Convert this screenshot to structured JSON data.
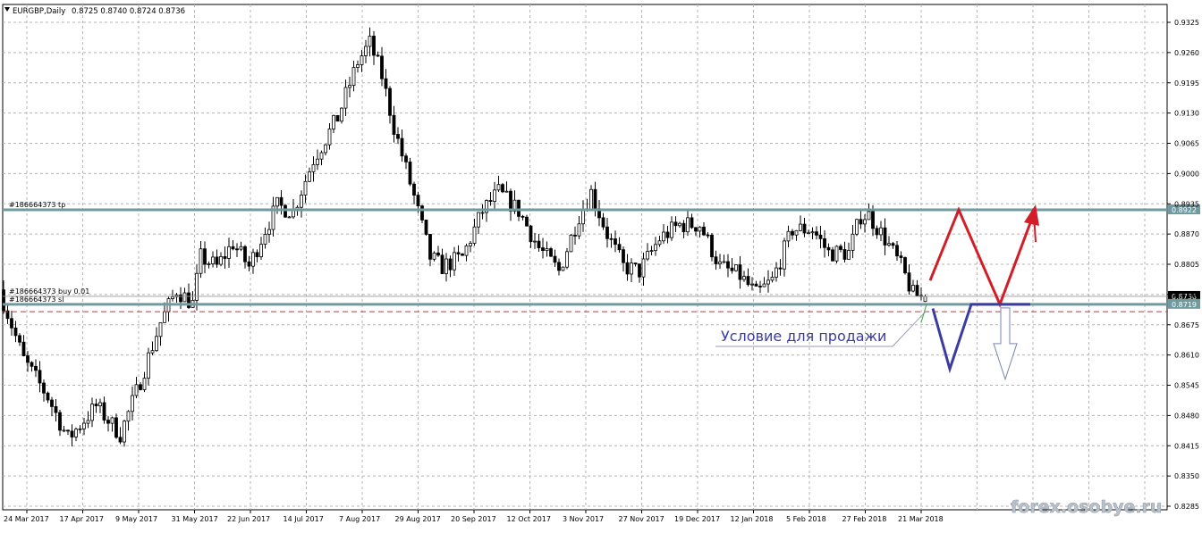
{
  "header": {
    "symbol": "EURGBP,Daily",
    "ohlc": "0.8725 0.8740 0.8724 0.8736"
  },
  "watermark": "forex.osobye.ru",
  "colors": {
    "background": "#ffffff",
    "grid": "#b4b4b4",
    "candle": "#000000",
    "level_line": "#6f9aa0",
    "dashed_line": "#c8323c",
    "price_tag": "#6f9aa0",
    "up_arrow": "#d21e28",
    "down_arrow": "#3c3ca0",
    "annotation_text": "#3c3ca0"
  },
  "chart_data": {
    "type": "candlestick",
    "title": "EURGBP,Daily",
    "y_ticks": [
      "0.9325",
      "0.9260",
      "0.9195",
      "0.9130",
      "0.9065",
      "0.9000",
      "0.8935",
      "0.8870",
      "0.8805",
      "0.8740",
      "0.8675",
      "0.8610",
      "0.8545",
      "0.8480",
      "0.8415",
      "0.8350",
      "0.8285"
    ],
    "x_ticks": [
      "24 Mar 2017",
      "17 Apr 2017",
      "9 May 2017",
      "31 May 2017",
      "22 Jun 2017",
      "14 Jul 2017",
      "7 Aug 2017",
      "29 Aug 2017",
      "20 Sep 2017",
      "12 Oct 2017",
      "3 Nov 2017",
      "27 Nov 2017",
      "19 Dec 2017",
      "12 Jan 2018",
      "5 Feb 2018",
      "27 Feb 2018",
      "21 Mar 2018"
    ],
    "ylim": [
      0.8285,
      0.9325
    ],
    "last": {
      "open": 0.8725,
      "high": 0.874,
      "low": 0.8724,
      "close": 0.8736
    },
    "price_path": [
      [
        0,
        0.875
      ],
      [
        6,
        0.86
      ],
      [
        12,
        0.852
      ],
      [
        17,
        0.843
      ],
      [
        21,
        0.847
      ],
      [
        24,
        0.85
      ],
      [
        30,
        0.844
      ],
      [
        34,
        0.853
      ],
      [
        40,
        0.868
      ],
      [
        44,
        0.875
      ],
      [
        48,
        0.872
      ],
      [
        50,
        0.882
      ],
      [
        54,
        0.88
      ],
      [
        58,
        0.885
      ],
      [
        62,
        0.88
      ],
      [
        66,
        0.888
      ],
      [
        69,
        0.893
      ],
      [
        73,
        0.892
      ],
      [
        78,
        0.903
      ],
      [
        84,
        0.912
      ],
      [
        89,
        0.924
      ],
      [
        92,
        0.928
      ],
      [
        95,
        0.921
      ],
      [
        98,
        0.91
      ],
      [
        103,
        0.895
      ],
      [
        107,
        0.882
      ],
      [
        110,
        0.88
      ],
      [
        115,
        0.882
      ],
      [
        120,
        0.892
      ],
      [
        124,
        0.896
      ],
      [
        129,
        0.892
      ],
      [
        134,
        0.884
      ],
      [
        139,
        0.879
      ],
      [
        144,
        0.891
      ],
      [
        147,
        0.896
      ],
      [
        151,
        0.887
      ],
      [
        155,
        0.88
      ],
      [
        159,
        0.879
      ],
      [
        164,
        0.886
      ],
      [
        169,
        0.889
      ],
      [
        174,
        0.889
      ],
      [
        179,
        0.88
      ],
      [
        184,
        0.878
      ],
      [
        188,
        0.874
      ],
      [
        192,
        0.877
      ],
      [
        197,
        0.888
      ],
      [
        202,
        0.888
      ],
      [
        206,
        0.883
      ],
      [
        211,
        0.883
      ],
      [
        214,
        0.891
      ],
      [
        216,
        0.891
      ],
      [
        220,
        0.886
      ],
      [
        224,
        0.88
      ],
      [
        227,
        0.874
      ],
      [
        229,
        0.8736
      ]
    ],
    "horizontal_lines": [
      {
        "label": "#186664373 tp",
        "price": 0.8922,
        "tag": "0.8922",
        "style": "solid"
      },
      {
        "label": "#186664373 buy 0.01",
        "price": 0.8736,
        "tag": "0.8736",
        "style": "thin"
      },
      {
        "label": "#186664373 sl",
        "price": 0.8719,
        "tag": "0.8719",
        "style": "solid"
      },
      {
        "label": "",
        "price": 0.8703,
        "tag": "",
        "style": "dashed"
      }
    ],
    "annotation": "Условие для продажи"
  }
}
